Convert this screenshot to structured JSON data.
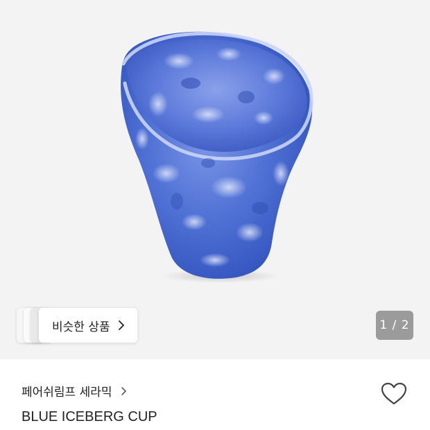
{
  "gallery": {
    "image_alt": "BLUE ICEBERG CUP",
    "similar_label": "비슷한 상품",
    "page_indicator": "1 / 2",
    "chevron_icon": "chevron-right-icon"
  },
  "product": {
    "brand": "페어쉬림프 세라믹",
    "name": "BLUE ICEBERG CUP",
    "wish_icon": "heart-outline-icon"
  },
  "colors": {
    "gallery_bg": "#f3f3f3",
    "cup_blue": "#4f6fd0",
    "indicator_bg": "#9b9b9b"
  }
}
